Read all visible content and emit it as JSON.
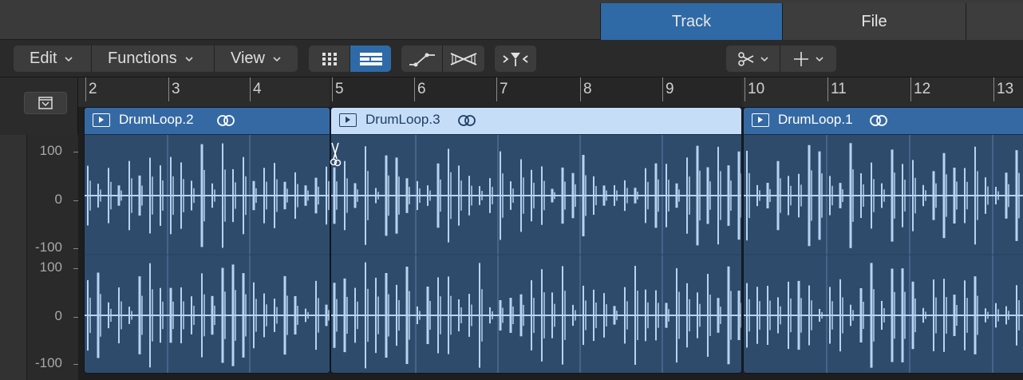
{
  "tabs": {
    "track": "Track",
    "file": "File"
  },
  "menus": {
    "edit": "Edit",
    "functions": "Functions",
    "view": "View"
  },
  "ruler": {
    "bars": [
      "2",
      "3",
      "4",
      "5",
      "6",
      "7",
      "8",
      "9",
      "10",
      "11",
      "12",
      "13"
    ]
  },
  "regions": [
    {
      "name": "DrumLoop.2",
      "selected": false
    },
    {
      "name": "DrumLoop.3",
      "selected": true
    },
    {
      "name": "DrumLoop.1",
      "selected": false
    }
  ],
  "amplitude_scale": {
    "top_channel": [
      "100",
      "0",
      "-100"
    ],
    "bottom_channel": [
      "100",
      "0",
      "-100"
    ]
  },
  "colors": {
    "accent": "#2f69a6",
    "region_fill": "#2e4b6c",
    "region_header": "#3569a4",
    "selected_header": "#c6ddf7",
    "waveform": "#b6d3f2"
  },
  "icons": [
    "chevron-down-icon",
    "grid-view-icon",
    "track-view-icon",
    "automation-curve-icon",
    "crossfade-icon",
    "flex-tool-icon",
    "scissors-tool-icon",
    "crosshair-tool-icon",
    "collapse-icon",
    "play-region-icon",
    "loop-icon",
    "scissors-cursor-icon"
  ]
}
